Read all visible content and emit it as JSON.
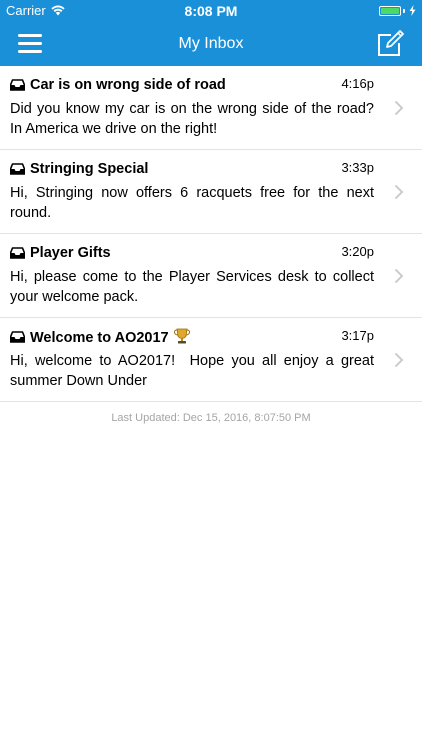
{
  "status_bar": {
    "carrier": "Carrier",
    "time": "8:08 PM",
    "battery_color": "#4cd964"
  },
  "nav": {
    "title": "My Inbox",
    "menu_icon": "hamburger-menu-icon",
    "compose_icon": "compose-icon",
    "background_color": "#1a90d9"
  },
  "messages": [
    {
      "icon": "inbox-tray-icon",
      "subject": "Car is on wrong side of road",
      "time": "4:16p",
      "body": "Did you know my car is on the wrong side of the road? In America we drive on the right!"
    },
    {
      "icon": "inbox-tray-icon",
      "subject": "Stringing Special",
      "time": "3:33p",
      "body": "Hi, Stringing now offers 6 racquets free for the next round."
    },
    {
      "icon": "inbox-tray-icon",
      "subject": "Player Gifts",
      "time": "3:20p",
      "body": "Hi, please come to the Player Services desk to collect your welcome pack."
    },
    {
      "icon": "inbox-tray-icon",
      "subject": "Welcome to AO2017",
      "subject_emoji": "trophy-icon",
      "time": "3:17p",
      "body": "Hi, welcome to AO2017!  Hope you all enjoy a great summer Down Under"
    }
  ],
  "footer": {
    "last_updated": "Last Updated: Dec 15, 2016, 8:07:50 PM"
  }
}
